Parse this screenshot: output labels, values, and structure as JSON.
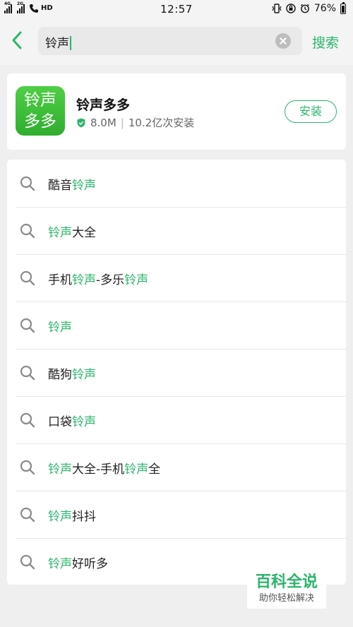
{
  "status_bar": {
    "network_1": "4G",
    "network_2": "2G",
    "hd_label": "HD",
    "time": "12:57",
    "battery_percent": "76%"
  },
  "search": {
    "query": "铃声",
    "search_button_label": "搜索"
  },
  "app_card": {
    "icon_line1": "铃声",
    "icon_line2": "多多",
    "icon_color": "#3cbf3a",
    "name": "铃声多多",
    "size": "8.0M",
    "separator": "|",
    "installs": "10.2亿次安装",
    "install_label": "安装"
  },
  "suggestions": [
    {
      "parts": [
        {
          "text": "酷音",
          "hl": false
        },
        {
          "text": "铃声",
          "hl": true
        }
      ]
    },
    {
      "parts": [
        {
          "text": "铃声",
          "hl": true
        },
        {
          "text": "大全",
          "hl": false
        }
      ]
    },
    {
      "parts": [
        {
          "text": "手机",
          "hl": false
        },
        {
          "text": "铃声",
          "hl": true
        },
        {
          "text": "-多乐",
          "hl": false
        },
        {
          "text": "铃声",
          "hl": true
        }
      ]
    },
    {
      "parts": [
        {
          "text": "铃声",
          "hl": true
        }
      ]
    },
    {
      "parts": [
        {
          "text": "酷狗",
          "hl": false
        },
        {
          "text": "铃声",
          "hl": true
        }
      ]
    },
    {
      "parts": [
        {
          "text": "口袋",
          "hl": false
        },
        {
          "text": "铃声",
          "hl": true
        }
      ]
    },
    {
      "parts": [
        {
          "text": "铃声",
          "hl": true
        },
        {
          "text": "大全-手机",
          "hl": false
        },
        {
          "text": "铃声",
          "hl": true
        },
        {
          "text": "全",
          "hl": false
        }
      ]
    },
    {
      "parts": [
        {
          "text": "铃声",
          "hl": true
        },
        {
          "text": "抖抖",
          "hl": false
        }
      ]
    },
    {
      "parts": [
        {
          "text": "铃声",
          "hl": true
        },
        {
          "text": "好听多",
          "hl": false
        }
      ]
    }
  ],
  "watermark": {
    "title": "百科全说",
    "subtitle": "助你轻松解决"
  },
  "colors": {
    "accent": "#2bb56b",
    "background": "#efefef"
  }
}
